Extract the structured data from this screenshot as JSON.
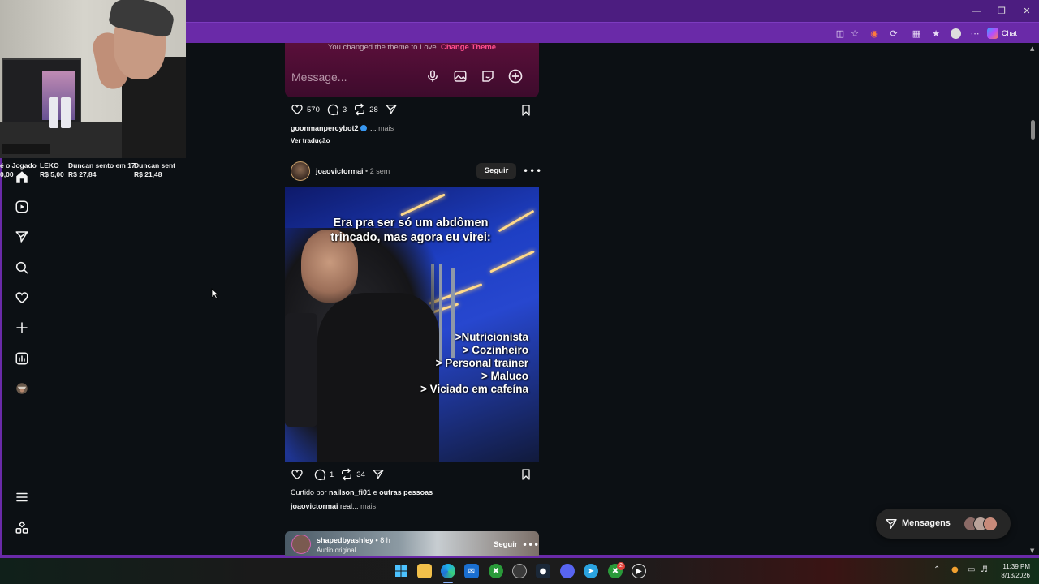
{
  "browser": {
    "chat_label": "Chat",
    "window_controls": [
      "minimize-icon",
      "restore-icon",
      "close-icon"
    ]
  },
  "stream_overlay": {
    "donations": [
      {
        "name": "é o Jogador",
        "amount": "0,00"
      },
      {
        "name": "LEKO",
        "amount": "R$ 5,00"
      },
      {
        "name": "Duncan sento em 17",
        "amount": "R$ 27,84"
      },
      {
        "name": "Duncan sent",
        "amount": "R$ 21,48"
      }
    ]
  },
  "nav": {
    "items": [
      "home-icon",
      "reels-icon",
      "direct-icon",
      "search-icon",
      "notifications-icon",
      "create-icon",
      "dashboard-icon",
      "profile-icon"
    ],
    "bottom": [
      "menu-icon",
      "more-apps-icon"
    ]
  },
  "dm_card": {
    "theme_note": "You changed the theme to Love.",
    "theme_link": "Change Theme",
    "placeholder": "Message..."
  },
  "post1": {
    "likes": "570",
    "comments": "3",
    "reposts": "28",
    "user": "goonmanpercybot2",
    "caption_dots": "...",
    "more": "mais",
    "see_translation": "Ver tradução"
  },
  "post2": {
    "user": "joaovictormai",
    "time": "2 sem",
    "follow": "Seguir",
    "image_title": "Era pra ser só um abdômen trincado, mas agora eu virei:",
    "image_list": [
      ">Nutricionista",
      "> Cozinheiro",
      "> Personal trainer",
      "> Maluco",
      "> Viciado em cafeína"
    ],
    "likes": "",
    "comments": "1",
    "reposts": "34",
    "liked_by_prefix": "Curtido por",
    "liked_by_user": "nailson_fi01",
    "liked_by_suffix": "e",
    "liked_by_others": "outras pessoas",
    "caption_user": "joaovictormai",
    "caption_text": "real...",
    "more": "mais"
  },
  "post3": {
    "user": "shapedbyashley",
    "time": "8 h",
    "audio": "Áudio original",
    "follow": "Seguir"
  },
  "messages": {
    "label": "Mensagens"
  },
  "taskbar": {
    "badge_count": "2",
    "time": "11:39 PM",
    "date": "8/13/2026"
  },
  "colors": {
    "browser_frame": "#6a2aa8",
    "titlebar": "#4c1d80",
    "page_bg": "#0c1014",
    "theme_link": "#ff4d8d",
    "verified": "#3897f0"
  }
}
